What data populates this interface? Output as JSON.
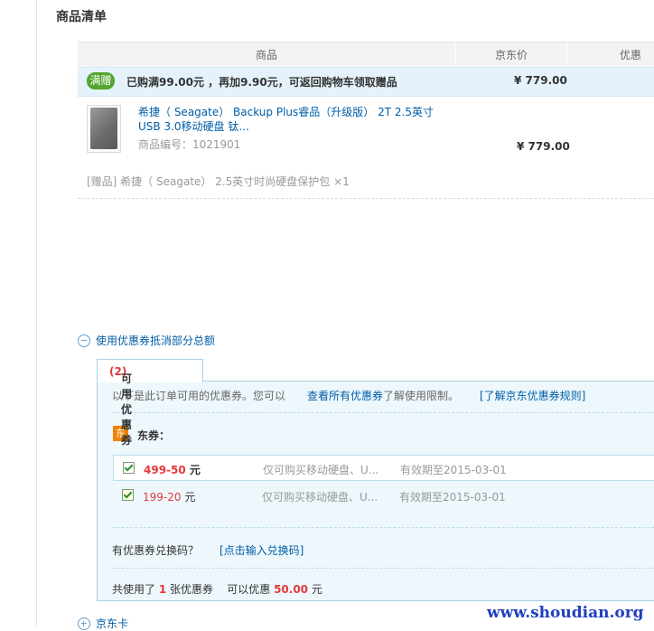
{
  "section_title": "商品清单",
  "table_header": {
    "product": "商品",
    "price": "京东价",
    "discount": "优惠"
  },
  "promo": {
    "badge": "满赠",
    "text": "已购满99.00元 ，再加9.90元，可返回购物车领取赠品",
    "price": "¥ 779.00"
  },
  "item": {
    "name": "希捷（ Seagate） Backup Plus睿品（升级版） 2T 2.5英寸 USB 3.0移动硬盘 钛...",
    "number_label": "商品编号：1021901",
    "price": "¥ 779.00",
    "gift": "[赠品] 希捷（ Seagate） 2.5英寸时尚硬盘保护包 ×1"
  },
  "coupon_toggle": "使用优惠券抵消部分总额",
  "coupon_tab": {
    "label": "可用优惠券",
    "count": "(2)"
  },
  "coupon_note": {
    "text1": "以下是此订单可用的优惠券。您可以",
    "link": "查看所有优惠券",
    "text2": "了解使用限制。",
    "rule_link": "[了解京东优惠券规则]"
  },
  "dong": {
    "icon": "东",
    "label": "东券："
  },
  "coupons": [
    {
      "amount": "499-50",
      "unit": "元",
      "scope": "仅可购买移动硬盘、U...",
      "validity": "有效期至2015-03-01"
    },
    {
      "amount": "199-20",
      "unit": "元",
      "scope": "仅可购买移动硬盘、U...",
      "validity": "有效期至2015-03-01"
    }
  ],
  "redeem": {
    "question": "有优惠券兑换码？",
    "link": "[点击输入兑换码]"
  },
  "summary": {
    "prefix": "共使用了 ",
    "count": "1",
    "mid": " 张优惠券    可以优惠 ",
    "amount": "50.00",
    "suffix": " 元"
  },
  "jd_card": "京东卡",
  "watermark": "www.shoudian.org",
  "colors": {
    "link": "#005ea7",
    "accent_red": "#e4393c",
    "badge_green": "#52a52e",
    "promo_bg": "#e5f2fb",
    "coupon_bg": "#edf7fc",
    "dong_orange": "#f08300"
  }
}
